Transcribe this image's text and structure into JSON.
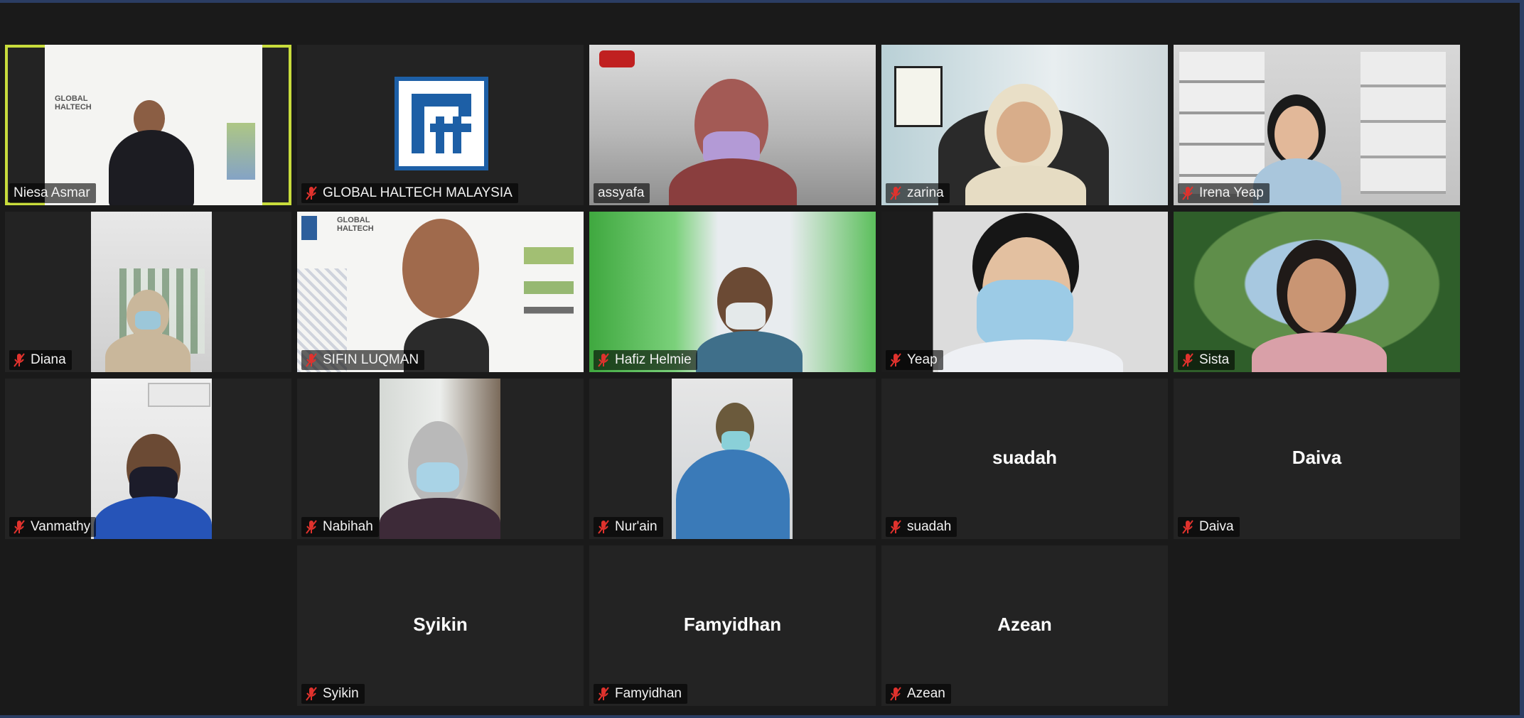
{
  "participants": [
    {
      "name": "Niesa Asmar",
      "caption": "Niesa Asmar"
    },
    {
      "name": "GLOBAL HALTECH MALAYSIA",
      "caption": "GLOBAL HALTECH MALAYSIA"
    },
    {
      "name": "assyafa",
      "caption": "assyafa"
    },
    {
      "name": "zarina",
      "caption": "zarina"
    },
    {
      "name": "Irena Yeap",
      "caption": "Irena Yeap"
    },
    {
      "name": "Diana",
      "caption": "Diana"
    },
    {
      "name": "Sifin Luqman",
      "caption": "SIFIN LUQMAN"
    },
    {
      "name": "Hafiz Helmie",
      "caption": "Hafiz Helmie"
    },
    {
      "name": "Yeap",
      "caption": "Yeap"
    },
    {
      "name": "Sista",
      "caption": "Sista"
    },
    {
      "name": "Vanmathy",
      "caption": "Vanmathy"
    },
    {
      "name": "Nabihah",
      "caption": "Nabihah"
    },
    {
      "name": "Nur'ain",
      "caption": "Nur'ain"
    },
    {
      "name": "suadah",
      "caption": "suadah",
      "center": "suadah"
    },
    {
      "name": "Daiva",
      "caption": "Daiva",
      "center": "Daiva"
    },
    {
      "name": "Syikin",
      "caption": "Syikin",
      "center": "Syikin"
    },
    {
      "name": "Famyidhan",
      "caption": "Famyidhan",
      "center": "Famyidhan"
    },
    {
      "name": "Azean",
      "caption": "Azean",
      "center": "Azean"
    }
  ],
  "icons": {
    "muted": "microphone-muted-icon"
  },
  "colors": {
    "active_speaker_border": "#c8dc3c",
    "muted_icon": "#e0322d",
    "tile_background": "#232323"
  }
}
